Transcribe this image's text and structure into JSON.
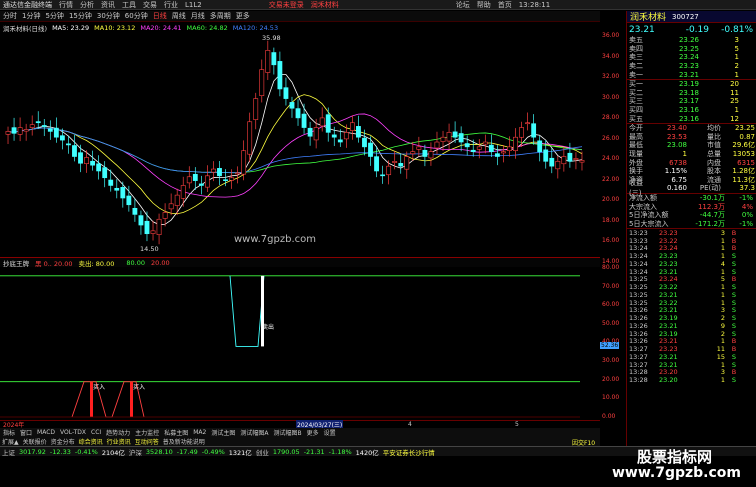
{
  "titlebar": {
    "app": "通达信金融终端",
    "menus": [
      "行情",
      "分析",
      "资讯",
      "工具",
      "交易",
      "行业",
      "L1L2"
    ],
    "center": [
      "交易未登录",
      "润禾材料"
    ],
    "right": [
      "论坛",
      "帮助",
      "首页"
    ],
    "time": "13:28:11"
  },
  "period": {
    "items": [
      "分时",
      "1分钟",
      "5分钟",
      "15分钟",
      "30分钟",
      "60分钟",
      "日线",
      "周线",
      "月线",
      "多周期",
      "更多"
    ],
    "selected": "日线"
  },
  "ma": {
    "stock": "润禾材料(日线)",
    "ma5": "MA5: 23.29",
    "ma10": "MA10: 23.12",
    "ma20": "MA20: 24.41",
    "ma60": "MA60: 24.82",
    "ma120": "MA120: 24.53"
  },
  "chart_labels": {
    "high": "35.98",
    "low": "14.50",
    "watermark": "www.7gpzb.com"
  },
  "price_axis": [
    "36.00",
    "34.00",
    "32.00",
    "30.00",
    "28.00",
    "26.00",
    "24.00",
    "22.00",
    "20.00",
    "18.00",
    "16.00",
    "14.00"
  ],
  "sub": {
    "name": "抄底王牌",
    "p1": "黑 0.. 20.00",
    "p2": "卖出: 80.00",
    "p3": "80.00",
    "p4": "20.00",
    "buy": "买入",
    "sell": "卖出"
  },
  "sub_axis": [
    "80.00",
    "70.00",
    "60.00",
    "50.00",
    "40.00",
    "30.00",
    "20.00",
    "10.00",
    "0.00"
  ],
  "sub_tag": "52.36",
  "dates": {
    "left": "2024年",
    "marker": "2024/03/27(三)",
    "m4": "4",
    "m5": "5",
    "m6": "6"
  },
  "tabs1": [
    "指标",
    "窗口",
    "MACD",
    "VOL-TDX",
    "CCI",
    "趋势动力",
    "主力监控",
    "私募主图",
    "MA2",
    "测试主图",
    "测试幅图A",
    "测试幅图B",
    "更多",
    "设置"
  ],
  "tabs2": [
    "扩展▲",
    "关联报价",
    "资金分布",
    "综合资讯",
    "行业资讯",
    "互动问答",
    "普及新功能说明"
  ],
  "status": {
    "sh_name": "上证",
    "sh": "3017.92",
    "sh_chg": "-12.33",
    "sh_pct": "-0.41%",
    "sh_amt": "2104亿",
    "sz_name": "沪深",
    "sz": "3528.10",
    "sz_chg": "-17.49",
    "sz_pct": "-0.49%",
    "sz_amt": "1321亿",
    "cy_name": "创业",
    "cy": "1790.05",
    "cy_chg": "-21.31",
    "cy_pct": "-1.18%",
    "cy_amt": "1420亿",
    "broker": "平安证券长沙行情",
    "extra": "因交F10"
  },
  "right": {
    "stock_name": "润禾材料",
    "code": "300727",
    "price": "23.21",
    "chg": "-0.19",
    "pct": "-0.81%",
    "asks": [
      [
        "卖五",
        "23.26",
        "3"
      ],
      [
        "卖四",
        "23.25",
        "5"
      ],
      [
        "卖三",
        "23.24",
        "1"
      ],
      [
        "卖二",
        "23.23",
        "2"
      ],
      [
        "卖一",
        "23.21",
        "1"
      ]
    ],
    "bids": [
      [
        "买一",
        "23.19",
        "20"
      ],
      [
        "买二",
        "23.18",
        "11"
      ],
      [
        "买三",
        "23.17",
        "25"
      ],
      [
        "买四",
        "23.16",
        "1"
      ],
      [
        "买五",
        "23.16",
        "12"
      ]
    ],
    "stats": [
      [
        "今开",
        "23.40",
        "均价",
        "23.25"
      ],
      [
        "最高",
        "23.53",
        "量比",
        "0.87"
      ],
      [
        "最低",
        "23.08",
        "市值",
        "29.6亿"
      ],
      [
        "现量",
        "1",
        "总量",
        "13053"
      ],
      [
        "外盘",
        "6738",
        "内盘",
        "6315"
      ],
      [
        "换手",
        "1.15%",
        "股本",
        "1.28亿"
      ],
      [
        "净资",
        "6.75",
        "流通",
        "11.3亿"
      ],
      [
        "收益(三)",
        "0.160",
        "PE(动)",
        "37.3"
      ]
    ],
    "flows": [
      [
        "净流入额",
        "-30.1万",
        "-1%"
      ],
      [
        "大宗流入",
        "112.3万",
        "4%"
      ],
      [
        "5日净流入额",
        "-44.7万",
        "0%"
      ],
      [
        "5日大宗流入",
        "-171.2万",
        "-1%"
      ]
    ],
    "ticks": [
      [
        "13:23",
        "23.23",
        "3",
        "B"
      ],
      [
        "13:23",
        "23.22",
        "1",
        "B"
      ],
      [
        "13:24",
        "23.24",
        "1",
        "B"
      ],
      [
        "13:24",
        "23.23",
        "1",
        "S"
      ],
      [
        "13:24",
        "23.23",
        "4",
        "S"
      ],
      [
        "13:24",
        "23.21",
        "1",
        "S"
      ],
      [
        "13:25",
        "23.24",
        "5",
        "B"
      ],
      [
        "13:25",
        "23.22",
        "1",
        "S"
      ],
      [
        "13:25",
        "23.21",
        "1",
        "S"
      ],
      [
        "13:25",
        "23.22",
        "1",
        "S"
      ],
      [
        "13:26",
        "23.21",
        "3",
        "S"
      ],
      [
        "13:26",
        "23.19",
        "2",
        "S"
      ],
      [
        "13:26",
        "23.21",
        "9",
        "S"
      ],
      [
        "13:26",
        "23.19",
        "2",
        "S"
      ],
      [
        "13:26",
        "23.21",
        "1",
        "B"
      ],
      [
        "13:27",
        "23.23",
        "11",
        "B"
      ],
      [
        "13:27",
        "23.21",
        "15",
        "S"
      ],
      [
        "13:27",
        "23.21",
        "1",
        "S"
      ],
      [
        "13:28",
        "23.20",
        "3",
        "B"
      ],
      [
        "13:28",
        "23.20",
        "1",
        "S"
      ]
    ]
  },
  "wm_banner": {
    "title": "股票指标网",
    "url": "www.7gpzb.com"
  },
  "colors": {
    "up": "#ff4040",
    "down": "#40ffff",
    "ma5": "#ffffff",
    "ma10": "#ffff40",
    "ma20": "#ff40ff",
    "ma60": "#40ff40",
    "ma120": "#4080ff"
  }
}
